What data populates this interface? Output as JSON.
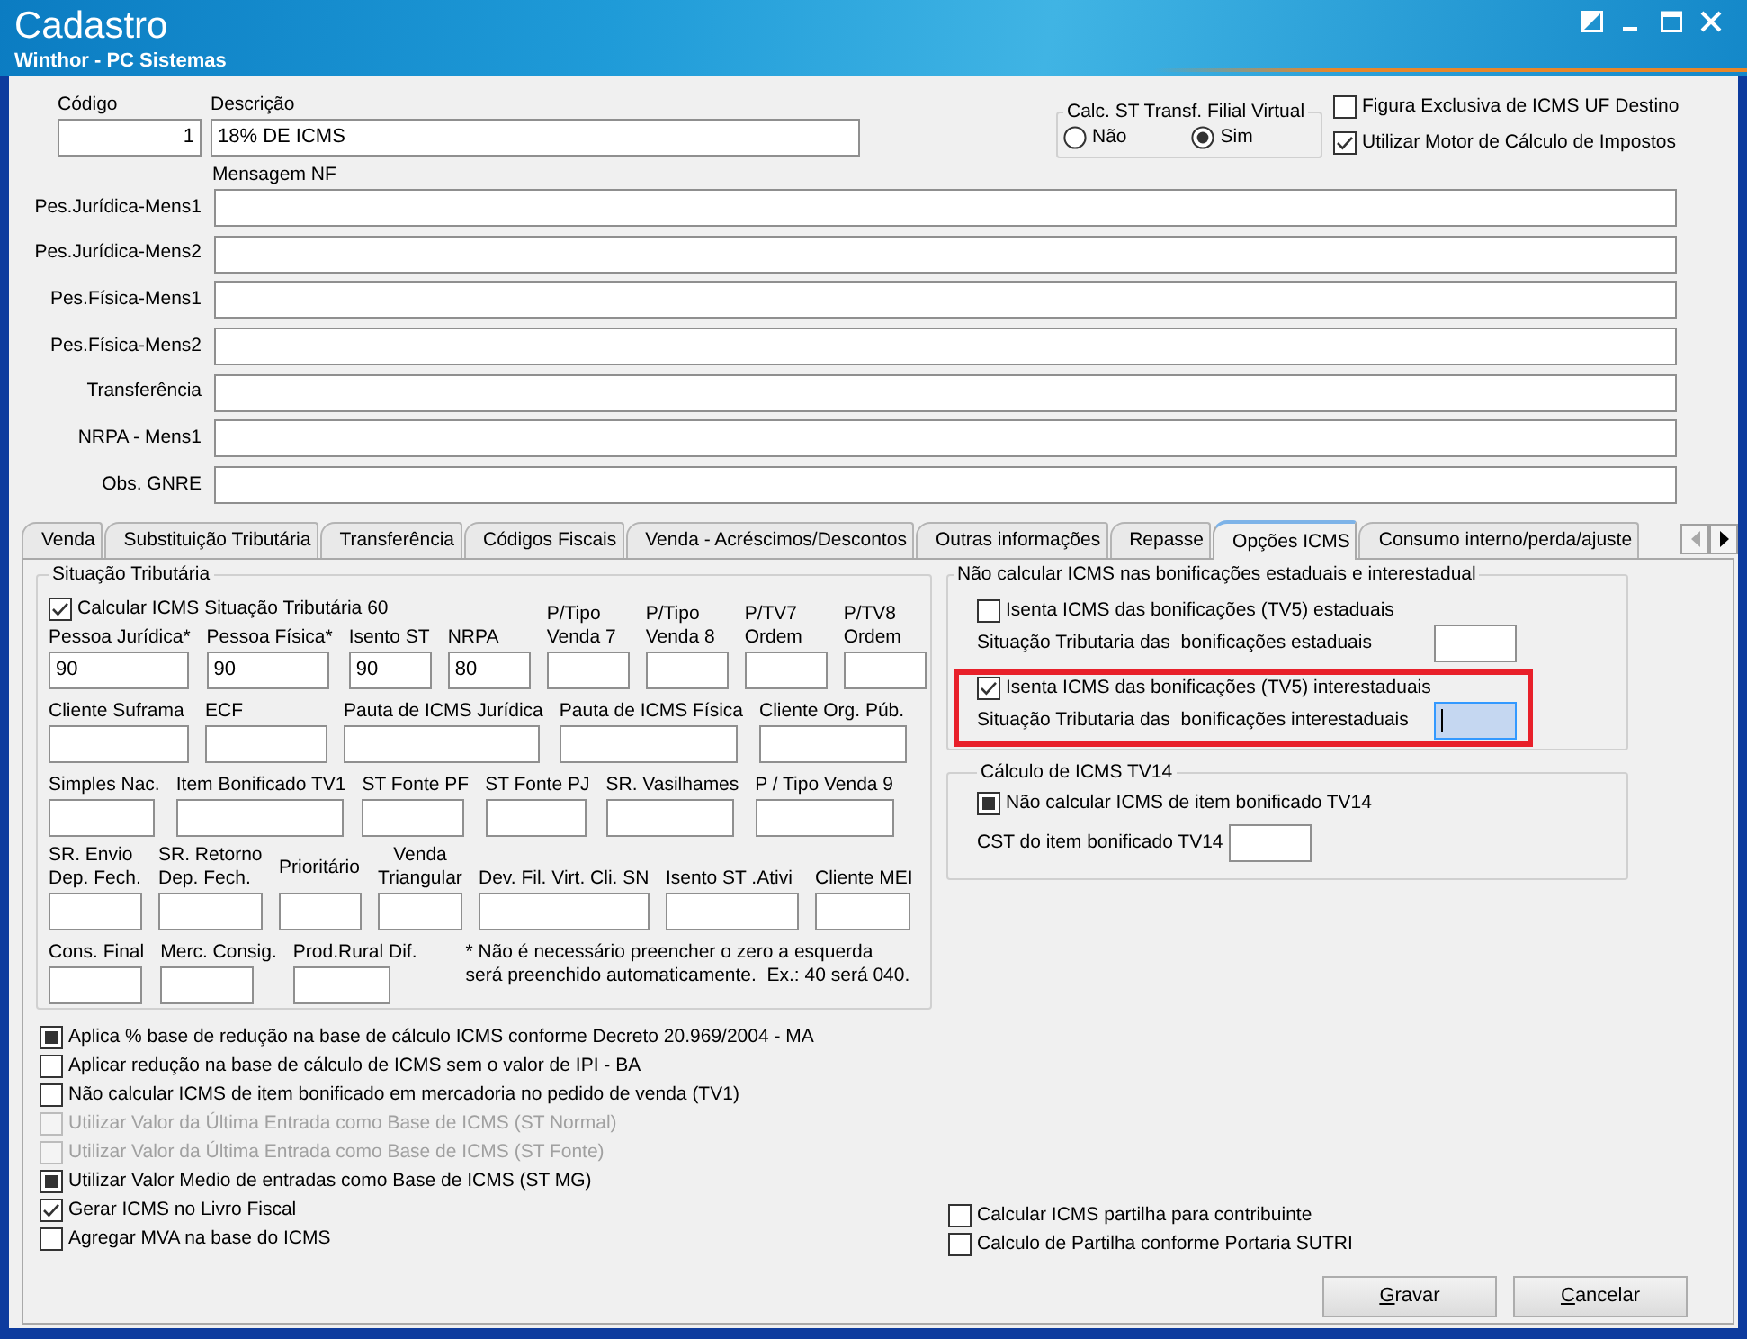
{
  "window": {
    "title": "Cadastro",
    "subtitle": "Winthor - PC Sistemas"
  },
  "header": {
    "code": {
      "label": "Código",
      "value": "1"
    },
    "description": {
      "label": "Descrição",
      "value": "18% DE ICMS"
    },
    "calc_st_group": {
      "title": "Calc. ST Transf. Filial Virtual",
      "options": [
        {
          "label": "Não",
          "selected": false
        },
        {
          "label": "Sim",
          "selected": true
        }
      ]
    },
    "checkboxes": [
      {
        "label": "Figura Exclusiva de ICMS UF Destino",
        "checked": false
      },
      {
        "label": "Utilizar Motor de Cálculo de Impostos",
        "checked": true
      }
    ]
  },
  "nf_messages": {
    "title": "Mensagem NF",
    "fields": [
      {
        "label": "Pes.Jurídica-Mens1"
      },
      {
        "label": "Pes.Jurídica-Mens2"
      },
      {
        "label": "Pes.Física-Mens1"
      },
      {
        "label": "Pes.Física-Mens2"
      },
      {
        "label": "Transferência"
      },
      {
        "label": "NRPA - Mens1"
      },
      {
        "label": "Obs. GNRE"
      }
    ]
  },
  "tabs": [
    {
      "label": "Venda",
      "selected": false
    },
    {
      "label": "Substituição Tributária",
      "selected": false
    },
    {
      "label": "Transferência",
      "selected": false
    },
    {
      "label": "Códigos Fiscais",
      "selected": false
    },
    {
      "label": "Venda - Acréscimos/Descontos",
      "selected": false
    },
    {
      "label": "Outras informações",
      "selected": false
    },
    {
      "label": "Repasse",
      "selected": false
    },
    {
      "label": "Opções ICMS",
      "selected": true
    },
    {
      "label": "Consumo interno/perda/ajuste",
      "selected": false
    }
  ],
  "tab_scroll": [
    {
      "kind": "left",
      "disabled": true
    },
    {
      "kind": "right",
      "disabled": false
    }
  ],
  "situacao_tributaria": {
    "title": "Situação Tributária",
    "checkbox": {
      "label": "Calcular ICMS Situação Tributária 60",
      "checked": true
    },
    "field_lines": [
      [
        {
          "label": "Pessoa Jurídica*",
          "value": "90"
        },
        {
          "label": "Pessoa Física*",
          "value": "90"
        },
        {
          "label": "Isento ST",
          "value": "90"
        },
        {
          "label": "NRPA",
          "value": "80"
        },
        {
          "label": "P/Tipo\nVenda 7"
        },
        {
          "label": "P/Tipo\nVenda 8"
        },
        {
          "label": "P/TV7\nOrdem"
        },
        {
          "label": "P/TV8\nOrdem"
        }
      ],
      [
        {
          "label": "Cliente Suframa"
        },
        {
          "label": "ECF"
        },
        {
          "label": "Pauta de ICMS Jurídica"
        },
        {
          "label": "Pauta de ICMS Física"
        },
        {
          "label": "Cliente Org. Púb."
        }
      ],
      [
        {
          "label": "Simples Nac."
        },
        {
          "label": "Item Bonificado TV1"
        },
        {
          "label": "ST Fonte PF"
        },
        {
          "label": "ST Fonte PJ"
        },
        {
          "label": "SR. Vasilhames"
        },
        {
          "label": "P / Tipo Venda 9"
        }
      ],
      [
        {
          "label": "SR. Envio\nDep. Fech."
        },
        {
          "label": "SR. Retorno\nDep. Fech."
        },
        {
          "label": "Prioritário"
        },
        {
          "label": "Venda\nTriangular"
        },
        {
          "label": "Dev. Fil. Virt. Cli. SN"
        },
        {
          "label": "Isento ST .Ativi"
        },
        {
          "label": "Cliente MEI"
        }
      ],
      [
        {
          "label": "Cons. Final"
        },
        {
          "label": "Merc. Consig."
        },
        {
          "label": "Prod.Rural Dif."
        }
      ]
    ],
    "note": "* Não é necessário preencher o zero a esquerda\nserá preenchido automaticamente.  Ex.: 40 será 040."
  },
  "bonus_group": {
    "title": "Não calcular ICMS nas bonificações estaduais e interestadual",
    "options": [
      {
        "checkbox": {
          "label": "Isenta ICMS das bonificações (TV5) estaduais",
          "checked": false
        },
        "field": {
          "label": "Situação Tributaria das  bonificações estaduais",
          "focused": false
        },
        "highlighted": false
      },
      {
        "checkbox": {
          "label": "Isenta ICMS das bonificações (TV5) interestaduais",
          "checked": true
        },
        "field": {
          "label": "Situação Tributaria das  bonificações interestaduais",
          "focused": true
        },
        "highlighted": true
      }
    ]
  },
  "tv14_group": {
    "title": "Cálculo de ICMS TV14",
    "checkbox": {
      "label": "Não calcular ICMS de item bonificado TV14",
      "checked": false,
      "indeterminate": true
    },
    "field": {
      "label": "CST do item bonificado TV14"
    }
  },
  "options": [
    {
      "label": "Aplica % base de redução na base de cálculo ICMS conforme Decreto 20.969/2004 - MA",
      "checked": false,
      "indeterminate": true,
      "disabled": false
    },
    {
      "label": "Aplicar redução na base de cálculo de ICMS sem o valor de IPI - BA",
      "checked": false,
      "indeterminate": false,
      "disabled": false
    },
    {
      "label": "Não calcular ICMS de item bonificado em mercadoria no pedido de venda (TV1)",
      "checked": false,
      "indeterminate": false,
      "disabled": false
    },
    {
      "label": "Utilizar Valor da Última Entrada como Base de ICMS (ST Normal)",
      "checked": false,
      "indeterminate": false,
      "disabled": true
    },
    {
      "label": "Utilizar Valor da Última Entrada como Base de ICMS (ST Fonte)",
      "checked": false,
      "indeterminate": false,
      "disabled": true
    },
    {
      "label": "Utilizar Valor Medio de entradas como Base de ICMS (ST MG)",
      "checked": false,
      "indeterminate": true,
      "disabled": false
    },
    {
      "label": "Gerar ICMS no Livro Fiscal",
      "checked": true,
      "indeterminate": false,
      "disabled": false
    },
    {
      "label": "Agregar MVA na base do ICMS",
      "checked": false,
      "indeterminate": false,
      "disabled": false
    }
  ],
  "partilha_options": [
    {
      "label": "Calcular ICMS partilha para contribuinte",
      "checked": false
    },
    {
      "label": "Calculo de Partilha conforme Portaria SUTRI",
      "checked": false
    }
  ],
  "buttons": [
    {
      "label": "Gravar"
    },
    {
      "label": "Cancelar"
    }
  ]
}
